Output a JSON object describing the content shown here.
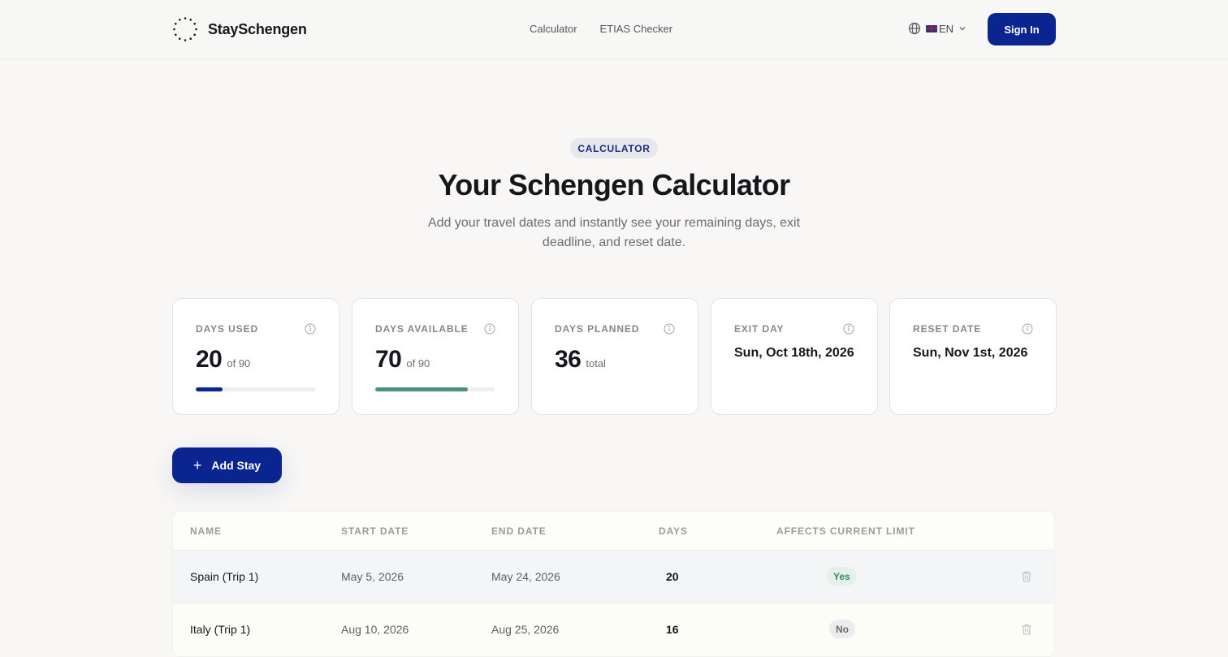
{
  "header": {
    "brand": "StaySchengen",
    "nav": [
      "Calculator",
      "ETIAS Checker"
    ],
    "language": "EN",
    "sign_in": "Sign In"
  },
  "hero": {
    "pill": "CALCULATOR",
    "title": "Your Schengen Calculator",
    "subtitle": "Add your travel dates and instantly see your remaining days, exit deadline, and reset date."
  },
  "stats": {
    "days_used": {
      "label": "DAYS USED",
      "value": "20",
      "suffix": "of 90",
      "progress": 0.222,
      "color": "#0b2590"
    },
    "days_available": {
      "label": "DAYS AVAILABLE",
      "value": "70",
      "suffix": "of 90",
      "progress": 0.778,
      "color": "#4c8f7e"
    },
    "days_planned": {
      "label": "DAYS PLANNED",
      "value": "36",
      "suffix": "total"
    },
    "exit_day": {
      "label": "EXIT DAY",
      "value": "Sun, Oct 18th, 2026"
    },
    "reset_date": {
      "label": "RESET DATE",
      "value": "Sun, Nov 1st, 2026"
    }
  },
  "actions": {
    "add_stay": "Add Stay"
  },
  "table": {
    "columns": [
      "NAME",
      "START DATE",
      "END DATE",
      "DAYS",
      "AFFECTS CURRENT LIMIT"
    ],
    "rows": [
      {
        "name": "Spain (Trip 1)",
        "start": "May 5, 2026",
        "end": "May 24, 2026",
        "days": "20",
        "affects": "Yes"
      },
      {
        "name": "Italy (Trip 1)",
        "start": "Aug 10, 2026",
        "end": "Aug 25, 2026",
        "days": "16",
        "affects": "No"
      }
    ]
  },
  "colors": {
    "primary": "#0b2590",
    "accent_green": "#4c8f7e",
    "background": "#f8f7f5"
  }
}
